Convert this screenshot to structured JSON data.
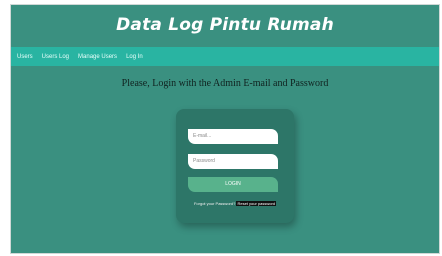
{
  "app": {
    "title": "Data Log Pintu Rumah"
  },
  "nav": {
    "items": [
      "Users",
      "Users Log",
      "Manage Users",
      "Log In"
    ]
  },
  "login": {
    "headline": "Please, Login with the Admin E-mail and Password",
    "email_placeholder": "E-mail...",
    "password_placeholder": "Password",
    "button_label": "LOGIN",
    "forgot_text": "Forgot your Password?",
    "reset_link": "Reset your password"
  },
  "colors": {
    "background": "#3a9080",
    "nav_bar": "#29b4a2",
    "card": "#2d7668",
    "button": "#58b28c"
  }
}
